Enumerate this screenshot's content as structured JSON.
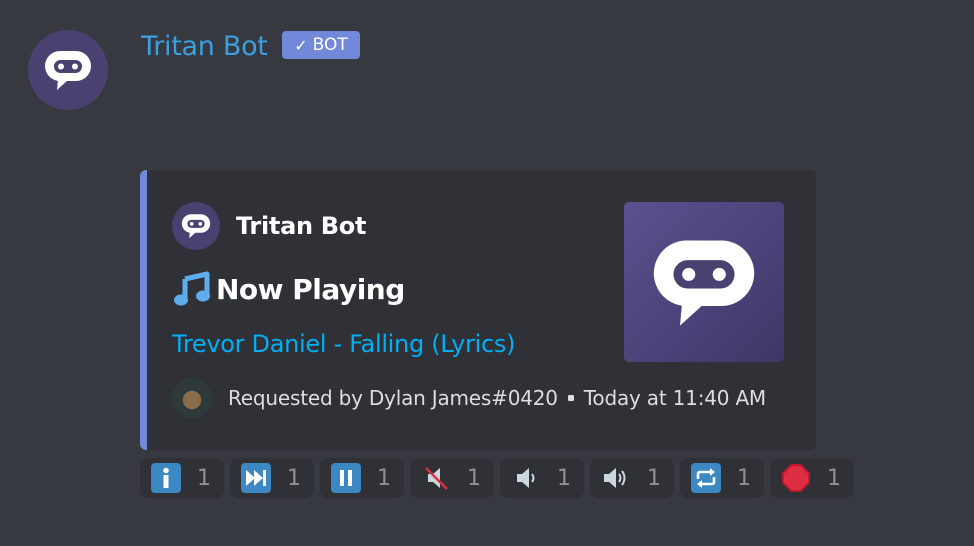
{
  "message": {
    "author": "Tritan Bot",
    "badge": "BOT",
    "badge_check": "✓"
  },
  "embed": {
    "accent_color": "#7289da",
    "author_name": "Tritan Bot",
    "title": "Now Playing",
    "title_icon": "musical-note-icon",
    "track_link_text": "Trevor Daniel - Falling (Lyrics)",
    "footer_requested": "Requested by Dylan James#0420",
    "footer_time": "Today at 11:40 AM"
  },
  "reactions": [
    {
      "icon": "info-icon",
      "count": "1"
    },
    {
      "icon": "next-track-icon",
      "count": "1"
    },
    {
      "icon": "pause-icon",
      "count": "1"
    },
    {
      "icon": "mute-icon",
      "count": "1"
    },
    {
      "icon": "volume-down-icon",
      "count": "1"
    },
    {
      "icon": "volume-up-icon",
      "count": "1"
    },
    {
      "icon": "repeat-icon",
      "count": "1"
    },
    {
      "icon": "stop-sign-icon",
      "count": "1"
    }
  ],
  "colors": {
    "background": "#36393f",
    "embed_bg": "#2f3136",
    "username": "#3d9ee0",
    "link": "#00aff4",
    "badge_bg": "#7289da"
  }
}
